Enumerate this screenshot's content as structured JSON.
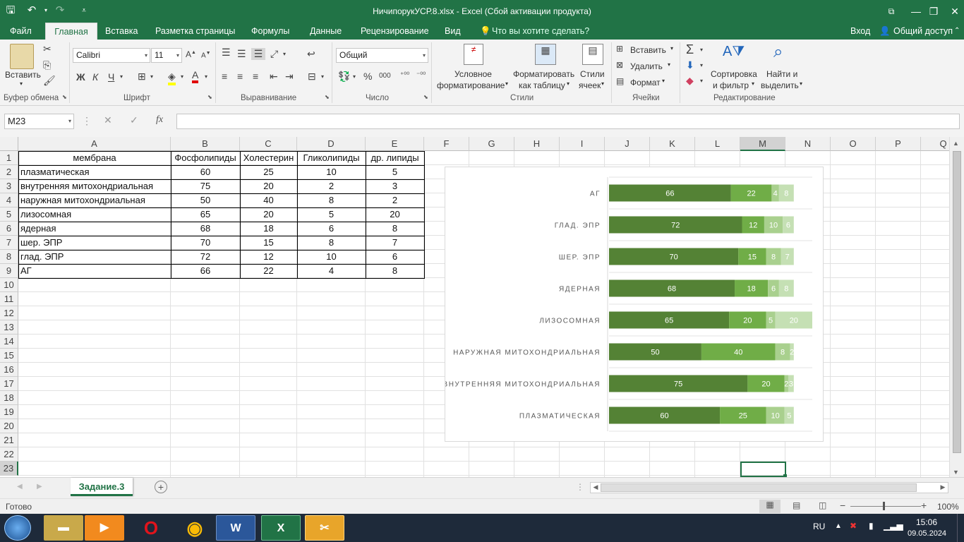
{
  "title": "НичипорукУСР.8.xlsx - Excel (Сбой активации продукта)",
  "quick_access": {
    "save_icon": "save-icon",
    "undo_icon": "undo-icon",
    "redo_icon": "redo-icon",
    "customize_icon": "customize-icon"
  },
  "menu": {
    "tabs": [
      "Файл",
      "Главная",
      "Вставка",
      "Разметка страницы",
      "Формулы",
      "Данные",
      "Рецензирование",
      "Вид"
    ],
    "active_tab": "Главная",
    "tell_me": "Что вы хотите сделать?",
    "signin": "Вход",
    "share": "Общий доступ"
  },
  "ribbon": {
    "clipboard": {
      "paste": "Вставить",
      "group": "Буфер обмена"
    },
    "font": {
      "name": "Calibri",
      "size": "11",
      "bold": "Ж",
      "italic": "К",
      "underline": "Ч",
      "group": "Шрифт"
    },
    "alignment": {
      "group": "Выравнивание"
    },
    "number": {
      "format": "Общий",
      "percent": "%",
      "thousands": "000",
      "group": "Число"
    },
    "styles": {
      "cond1": "Условное",
      "cond2": "форматирование",
      "table1": "Форматировать",
      "table2": "как таблицу",
      "cell1": "Стили",
      "cell2": "ячеек",
      "group": "Стили"
    },
    "cells": {
      "insert": "Вставить",
      "delete": "Удалить",
      "format": "Формат",
      "group": "Ячейки"
    },
    "editing": {
      "sort1": "Сортировка",
      "sort2": "и фильтр",
      "find1": "Найти и",
      "find2": "выделить",
      "group": "Редактирование"
    }
  },
  "formula_bar": {
    "name_box": "M23",
    "fx": "fx",
    "value": ""
  },
  "grid": {
    "columns": [
      "A",
      "B",
      "C",
      "D",
      "E",
      "F",
      "G",
      "H",
      "I",
      "J",
      "K",
      "L",
      "M",
      "N",
      "O",
      "P",
      "Q"
    ],
    "rows": [
      "1",
      "2",
      "3",
      "4",
      "5",
      "6",
      "7",
      "8",
      "9",
      "10",
      "11",
      "12",
      "13",
      "14",
      "15",
      "16",
      "17",
      "18",
      "19",
      "20",
      "21",
      "22",
      "23"
    ],
    "headers": [
      "мембрана",
      "Фосфолипиды",
      "Холестерин",
      "Гликолипиды",
      "др. липиды"
    ],
    "data": [
      [
        "плазматическая",
        "60",
        "25",
        "10",
        "5"
      ],
      [
        "внутренняя митохондриальная",
        "75",
        "20",
        "2",
        "3"
      ],
      [
        "наружная митохондриальная",
        "50",
        "40",
        "8",
        "2"
      ],
      [
        "лизосомная",
        "65",
        "20",
        "5",
        "20"
      ],
      [
        "ядерная",
        "68",
        "18",
        "6",
        "8"
      ],
      [
        "шер. ЭПР",
        "70",
        "15",
        "8",
        "7"
      ],
      [
        "глад. ЭПР",
        "72",
        "12",
        "10",
        "6"
      ],
      [
        "АГ",
        "66",
        "22",
        "4",
        "8"
      ]
    ]
  },
  "chart_data": {
    "type": "bar",
    "orientation": "horizontal",
    "stacked": true,
    "categories": [
      "АГ",
      "ГЛАД. ЭПР",
      "ШЕР. ЭПР",
      "ЯДЕРНАЯ",
      "ЛИЗОСОМНАЯ",
      "НАРУЖНАЯ МИТОХОНДРИАЛЬНАЯ",
      "ВНУТРЕННЯЯ МИТОХОНДРИАЛЬНАЯ",
      "ПЛАЗМАТИЧЕСКАЯ"
    ],
    "series": [
      {
        "values": [
          66,
          72,
          70,
          68,
          65,
          50,
          75,
          60
        ],
        "color": "#548235"
      },
      {
        "values": [
          22,
          12,
          15,
          18,
          20,
          40,
          20,
          25
        ],
        "color": "#70ad47"
      },
      {
        "values": [
          4,
          10,
          8,
          6,
          5,
          8,
          2,
          10
        ],
        "color": "#a9d08e"
      },
      {
        "values": [
          8,
          6,
          7,
          8,
          20,
          2,
          3,
          5
        ],
        "color": "#c5e0b4"
      }
    ],
    "xlim": [
      0,
      110
    ],
    "grid": true,
    "legend": "none",
    "data_labels": true
  },
  "sheet_tabs": {
    "active": "Задание.3",
    "add_icon": "add-sheet-icon"
  },
  "status": {
    "ready": "Готово",
    "zoom": "100%"
  },
  "taskbar": {
    "lang": "RU",
    "time": "15:06",
    "date": "09.05.2024"
  },
  "colors": {
    "excel_green": "#217346",
    "ribbon_bg": "#f3f3f3"
  }
}
